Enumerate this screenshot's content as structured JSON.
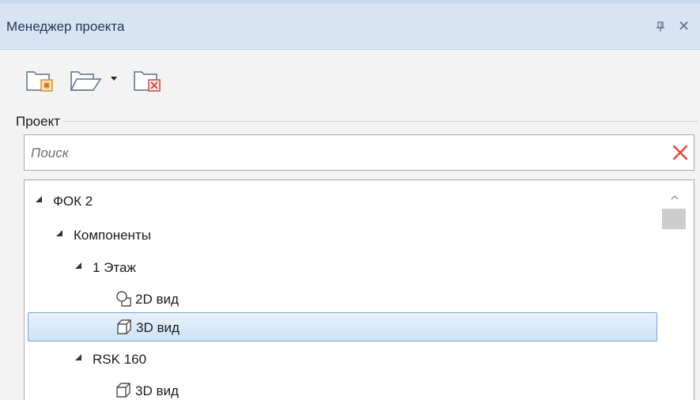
{
  "panel": {
    "title": "Менеджер проекта",
    "pin_icon": "pin-icon",
    "close_icon": "close-icon",
    "close_glyph": "✕"
  },
  "toolbar": {
    "buttons": [
      {
        "name": "new-project-icon"
      },
      {
        "name": "open-project-icon"
      },
      {
        "name": "close-project-icon"
      }
    ]
  },
  "project_group": {
    "label": "Проект"
  },
  "search": {
    "placeholder": "Поиск",
    "value": ""
  },
  "tree": {
    "items": [
      {
        "label": "ФОК 2",
        "level": 0,
        "expanded": true,
        "icon": null
      },
      {
        "label": "Компоненты",
        "level": 1,
        "expanded": true,
        "icon": null
      },
      {
        "label": "1 Этаж",
        "level": 2,
        "expanded": true,
        "icon": null
      },
      {
        "label": "2D вид",
        "level": 3,
        "icon": "2d-view-icon"
      },
      {
        "label": "3D вид",
        "level": 3,
        "icon": "3d-view-icon",
        "selected": true
      },
      {
        "label": "RSK 160",
        "level": 2,
        "expanded": true,
        "icon": null
      },
      {
        "label": "3D вид",
        "level": 3,
        "icon": "3d-view-icon"
      }
    ]
  },
  "colors": {
    "title_bar": "#d8e4f3",
    "selection": "#cfe2f8",
    "clear_icon": "#e0473a"
  }
}
